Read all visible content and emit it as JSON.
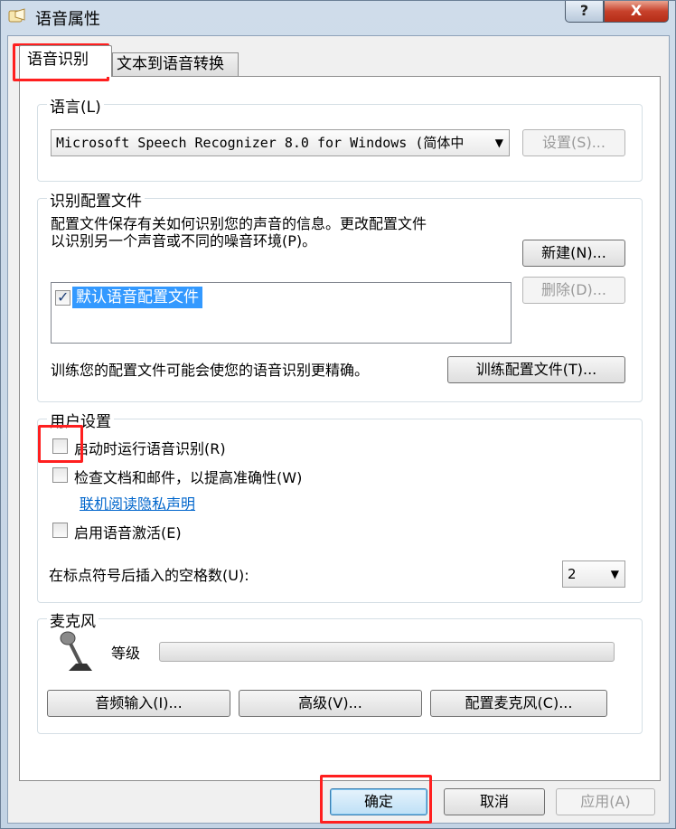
{
  "window": {
    "title": "语音属性",
    "help_label": "?",
    "close_label": "X"
  },
  "tabs": [
    {
      "label": "语音识别"
    },
    {
      "label": "文本到语音转换"
    }
  ],
  "language": {
    "group_title": "语言(L)",
    "selected": "Microsoft Speech Recognizer 8.0 for Windows (简体中",
    "settings_button": "设置(S)..."
  },
  "profile": {
    "group_title": "识别配置文件",
    "description_line1": "配置文件保存有关如何识别您的声音的信息。更改配置文件",
    "description_line2": "以识别另一个声音或不同的噪音环境(P)。",
    "new_button": "新建(N)...",
    "delete_button": "删除(D)...",
    "items": [
      {
        "label": "默认语音配置文件",
        "checked": true
      }
    ],
    "train_hint": "训练您的配置文件可能会使您的语音识别更精确。",
    "train_button": "训练配置文件(T)..."
  },
  "user_settings": {
    "group_title": "用户设置",
    "run_at_startup": "启动时运行语音识别(R)",
    "review_documents": "检查文档和邮件，以提高准确性(W)",
    "privacy_link": "联机阅读隐私声明",
    "voice_activation": "启用语音激活(E)",
    "spaces_label": "在标点符号后插入的空格数(U):",
    "spaces_value": "2"
  },
  "microphone": {
    "group_title": "麦克风",
    "level_label": "等级",
    "level_fraction": 0,
    "audio_input_button": "音频输入(I)...",
    "advanced_button": "高级(V)...",
    "configure_button": "配置麦克风(C)..."
  },
  "footer": {
    "ok_button": "确定",
    "cancel_button": "取消",
    "apply_button": "应用(A)"
  },
  "colors": {
    "highlight": "#ff1f1f",
    "link": "#0066cc",
    "selection": "#3399ff"
  }
}
